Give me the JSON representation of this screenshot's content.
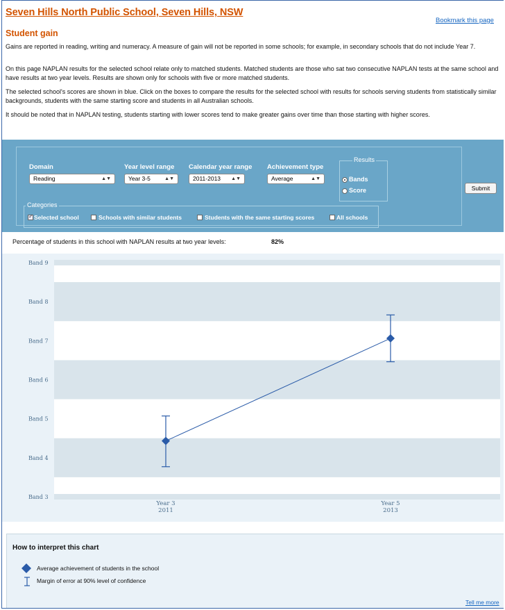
{
  "header": {
    "school_title": "Seven Hills North Public School, Seven Hills, NSW",
    "bookmark_link": "Bookmark this page"
  },
  "section": {
    "title": "Student gain",
    "paragraphs": [
      "Gains are reported in reading, writing and numeracy. A measure of gain will not be reported in some schools; for example, in secondary schools that do not include Year 7.",
      "On this page NAPLAN results for the selected school relate only to matched students. Matched students are those who sat two consecutive NAPLAN tests at the same school and have results at two year levels. Results are shown only for schools with five or more matched students.",
      "The selected school's scores are shown in blue. Click on the boxes to compare the results for the selected school with results for schools serving students from statistically similar backgrounds, students with the same starting score and students in all Australian schools.",
      "It should be noted that in NAPLAN testing, students starting with lower scores tend to make greater gains over time than those starting with higher scores."
    ]
  },
  "filters": {
    "domain": {
      "label": "Domain",
      "value": "Reading"
    },
    "year_level": {
      "label": "Year level range",
      "value": "Year 3-5"
    },
    "calendar_year": {
      "label": "Calendar year range",
      "value": "2011-2013"
    },
    "achievement": {
      "label": "Achievement type",
      "value": "Average"
    },
    "results": {
      "legend": "Results",
      "options": [
        {
          "label": "Bands",
          "selected": true
        },
        {
          "label": "Score",
          "selected": false
        }
      ]
    },
    "categories": {
      "legend": "Categories",
      "options": [
        {
          "label": "Selected school",
          "checked": true
        },
        {
          "label": "Schools with similar students",
          "checked": false
        },
        {
          "label": "Students with the same starting scores",
          "checked": false
        },
        {
          "label": "All schools",
          "checked": false
        }
      ]
    },
    "submit_label": "Submit"
  },
  "percentage": {
    "label": "Percentage of students in this school with NAPLAN results at two year levels:",
    "value": "82%"
  },
  "chart_data": {
    "type": "line",
    "y_categories": [
      "Band 3",
      "Band 4",
      "Band 5",
      "Band 6",
      "Band 7",
      "Band 8",
      "Band 9"
    ],
    "ylim": [
      3,
      9
    ],
    "categories": [
      {
        "label": "Year 3",
        "sub": "2011"
      },
      {
        "label": "Year 5",
        "sub": "2013"
      }
    ],
    "series": [
      {
        "values": [
          4.43,
          7.06
        ],
        "error_low": [
          3.77,
          6.46
        ],
        "error_high": [
          5.07,
          7.66
        ]
      }
    ],
    "grid": true,
    "colors": {
      "series": "#2a5ba8",
      "band_shade": "#d9e4eb",
      "band_light": "#eaf2f8"
    }
  },
  "interpret": {
    "title": "How to interpret this chart",
    "keys": [
      {
        "icon": "diamond-icon",
        "label": "Average achievement of students in the school"
      },
      {
        "icon": "error-bar-icon",
        "label": "Margin of error at 90% level of confidence"
      }
    ],
    "tell_more": "Tell me more"
  }
}
